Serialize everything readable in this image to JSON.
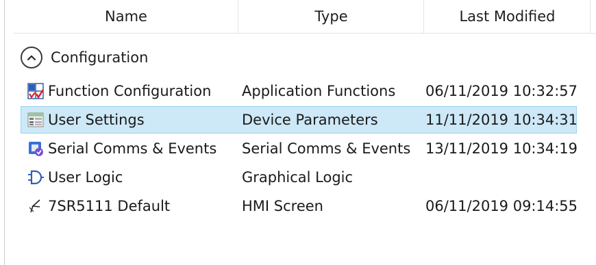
{
  "columns": {
    "name": "Name",
    "type": "Type",
    "last_modified": "Last Modified"
  },
  "group": {
    "label": "Configuration",
    "state": "expanded"
  },
  "rows": [
    {
      "name": "Function Configuration",
      "type": "Application Functions",
      "modified": "06/11/2019 10:32:57",
      "icon": "function-config-icon",
      "selected": false
    },
    {
      "name": "User Settings",
      "type": "Device Parameters",
      "modified": "11/11/2019 10:34:31",
      "icon": "settings-table-icon",
      "selected": true
    },
    {
      "name": "Serial Comms & Events",
      "type": "Serial Comms & Events",
      "modified": "13/11/2019 10:34:19",
      "icon": "serial-comms-icon",
      "selected": false
    },
    {
      "name": "User Logic",
      "type": "Graphical Logic",
      "modified": "",
      "icon": "logic-gate-icon",
      "selected": false
    },
    {
      "name": "7SR5111 Default",
      "type": "HMI Screen",
      "modified": "06/11/2019 09:14:55",
      "icon": "hmi-screen-icon",
      "selected": false
    }
  ],
  "colors": {
    "selection_bg": "#cde8f7",
    "selection_border": "#99d1ef"
  }
}
